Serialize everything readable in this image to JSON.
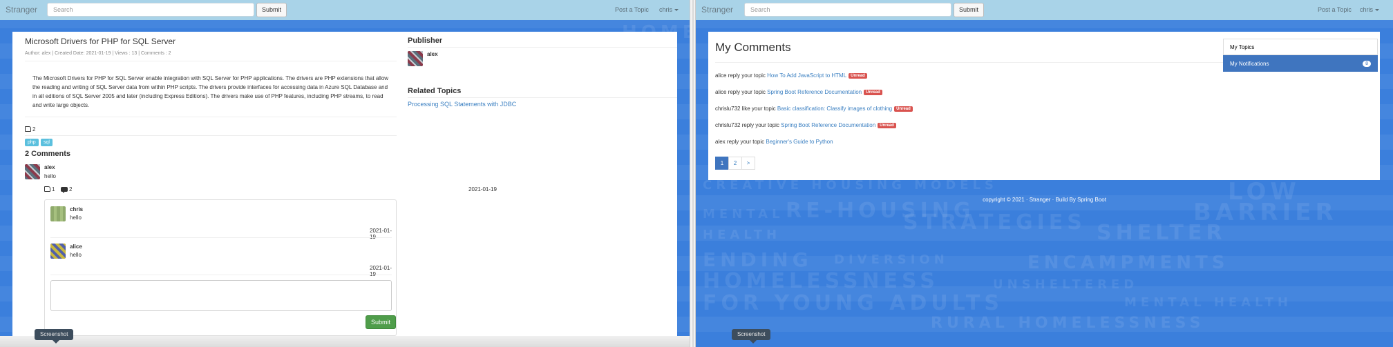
{
  "left": {
    "navbar": {
      "brand": "Stranger",
      "search_placeholder": "Search",
      "submit_label": "Submit",
      "post_topic_label": "Post a Topic",
      "user_label": "chris"
    },
    "topic": {
      "title": "Microsoft Drivers for PHP for SQL Server",
      "meta": "Author: alex | Created Date: 2021-01-19 | Views : 13 | Comments : 2",
      "body": "The Microsoft Drivers for PHP for SQL Server enable integration with SQL Server for PHP applications. The drivers are PHP extensions that allow the reading and writing of SQL Server data from within PHP scripts. The drivers provide interfaces for accessing data in Azure SQL Database and in all editions of SQL Server 2005 and later (including Express Editions). The drivers make use of PHP features, including PHP streams, to read and write large objects.",
      "likes": "2",
      "tags": [
        "php",
        "sql"
      ],
      "comments_heading": "2 Comments"
    },
    "comment": {
      "author": "alex",
      "text": "hello",
      "likes": "1",
      "replies": "2",
      "date": "2021-01-19"
    },
    "replies": [
      {
        "author": "chris",
        "text": "hello",
        "date": "2021-01-19"
      },
      {
        "author": "alice",
        "text": "hello",
        "date": "2021-01-19"
      }
    ],
    "reply_submit_label": "Submit",
    "sidebar": {
      "publisher_heading": "Publisher",
      "publisher_name": "alex",
      "related_heading": "Related Topics",
      "related_link": "Processing SQL Statements with JDBC"
    },
    "screenshot_label": "Screenshot"
  },
  "right": {
    "navbar": {
      "brand": "Stranger",
      "search_placeholder": "Search",
      "submit_label": "Submit",
      "post_topic_label": "Post a Topic",
      "user_label": "chris"
    },
    "page_title": "My Comments",
    "notifications": [
      {
        "prefix": "alice reply your topic",
        "link": "How To Add JavaScript to HTML",
        "badge": "Unread"
      },
      {
        "prefix": "alice reply your topic",
        "link": "Spring Boot Reference Documentation",
        "badge": "Unread"
      },
      {
        "prefix": "chrislu732 like your topic",
        "link": "Basic classification: Classify images of clothing",
        "badge": "Unread"
      },
      {
        "prefix": "chrislu732 reply your topic",
        "link": "Spring Boot Reference Documentation",
        "badge": "Unread"
      },
      {
        "prefix": "alex reply your topic",
        "link": "Beginner's Guide to Python",
        "badge": ""
      }
    ],
    "pagination": [
      "1",
      "2",
      ">"
    ],
    "menu": {
      "my_topics": "My Topics",
      "my_notifications": "My Notifications",
      "notif_count": "8"
    },
    "footer": "copyright © 2021 · Stranger · Build By Spring Boot",
    "screenshot_label": "Screenshot",
    "bg_words": [
      "HOMELESSN",
      "CREATIVE HOUSING MODELS",
      "MENTAL",
      "RE-HOUSING",
      "STRATEGIES",
      "HEALTH",
      "LOW",
      "BARRIER",
      "SHELTER",
      "ENDING",
      "DIVERSION",
      "ENCAMPMENTS",
      "HOMELESSNESS",
      "UNSHELTERED",
      "FOR YOUNG ADULTS",
      "MENTAL HEALTH",
      "RURAL HOMELESSNESS"
    ]
  }
}
